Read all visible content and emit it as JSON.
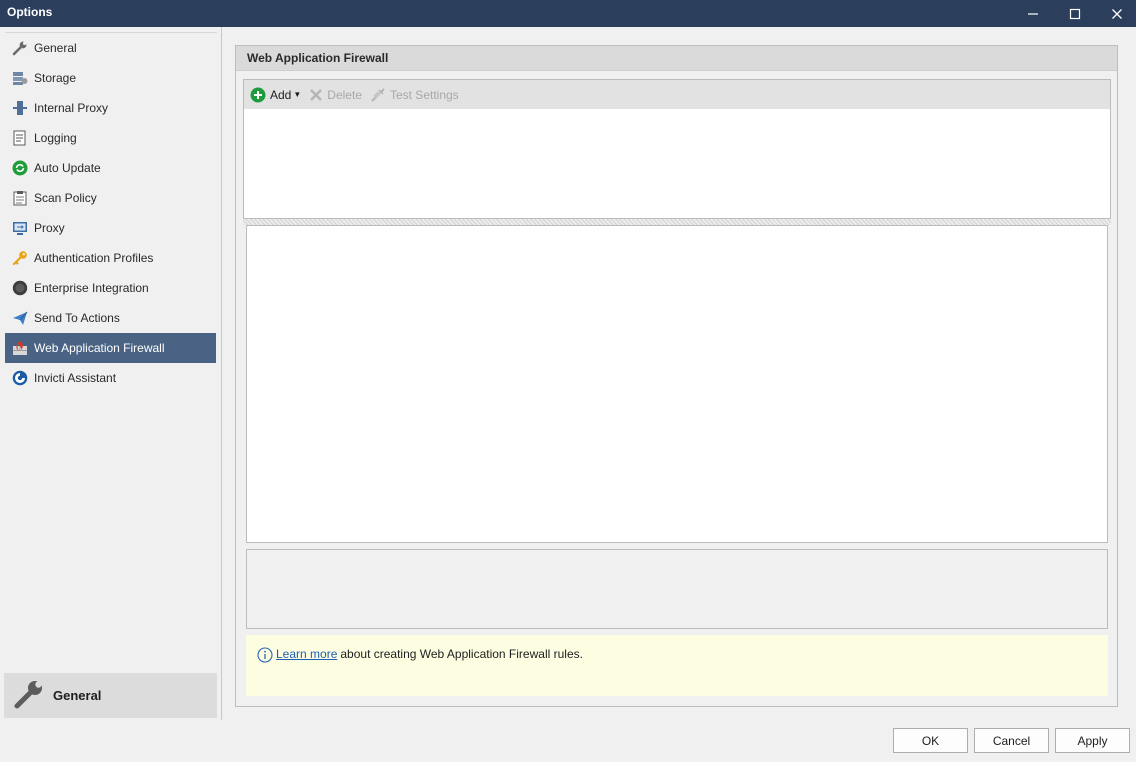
{
  "window": {
    "title": "Options",
    "minimize_icon": "minimize-icon",
    "maximize_icon": "maximize-icon",
    "close_icon": "close-icon"
  },
  "sidebar": {
    "items": [
      {
        "label": "General",
        "icon": "wrench-icon"
      },
      {
        "label": "Storage",
        "icon": "storage-icon"
      },
      {
        "label": "Internal Proxy",
        "icon": "internal-proxy-icon"
      },
      {
        "label": "Logging",
        "icon": "log-icon"
      },
      {
        "label": "Auto Update",
        "icon": "refresh-icon"
      },
      {
        "label": "Scan Policy",
        "icon": "policy-icon"
      },
      {
        "label": "Proxy",
        "icon": "proxy-icon"
      },
      {
        "label": "Authentication Profiles",
        "icon": "key-icon"
      },
      {
        "label": "Enterprise Integration",
        "icon": "enterprise-icon"
      },
      {
        "label": "Send To Actions",
        "icon": "send-icon"
      },
      {
        "label": "Web Application Firewall",
        "icon": "firewall-icon",
        "selected": true
      },
      {
        "label": "Invicti Assistant",
        "icon": "assistant-icon"
      }
    ],
    "bottom_group": {
      "label": "General",
      "icon": "wrench-icon"
    }
  },
  "panel": {
    "title": "Web Application Firewall",
    "toolbar": {
      "add_label": "Add",
      "delete_label": "Delete",
      "test_settings_label": "Test Settings"
    },
    "note": {
      "link_text": "Learn more",
      "text": "about creating Web Application Firewall rules."
    }
  },
  "footer": {
    "ok_label": "OK",
    "cancel_label": "Cancel",
    "apply_label": "Apply"
  },
  "colors": {
    "titlebar": "#2b3f5c",
    "selected_item": "#4a6384",
    "note_background": "#fdfde2",
    "link": "#1e5fb4"
  }
}
